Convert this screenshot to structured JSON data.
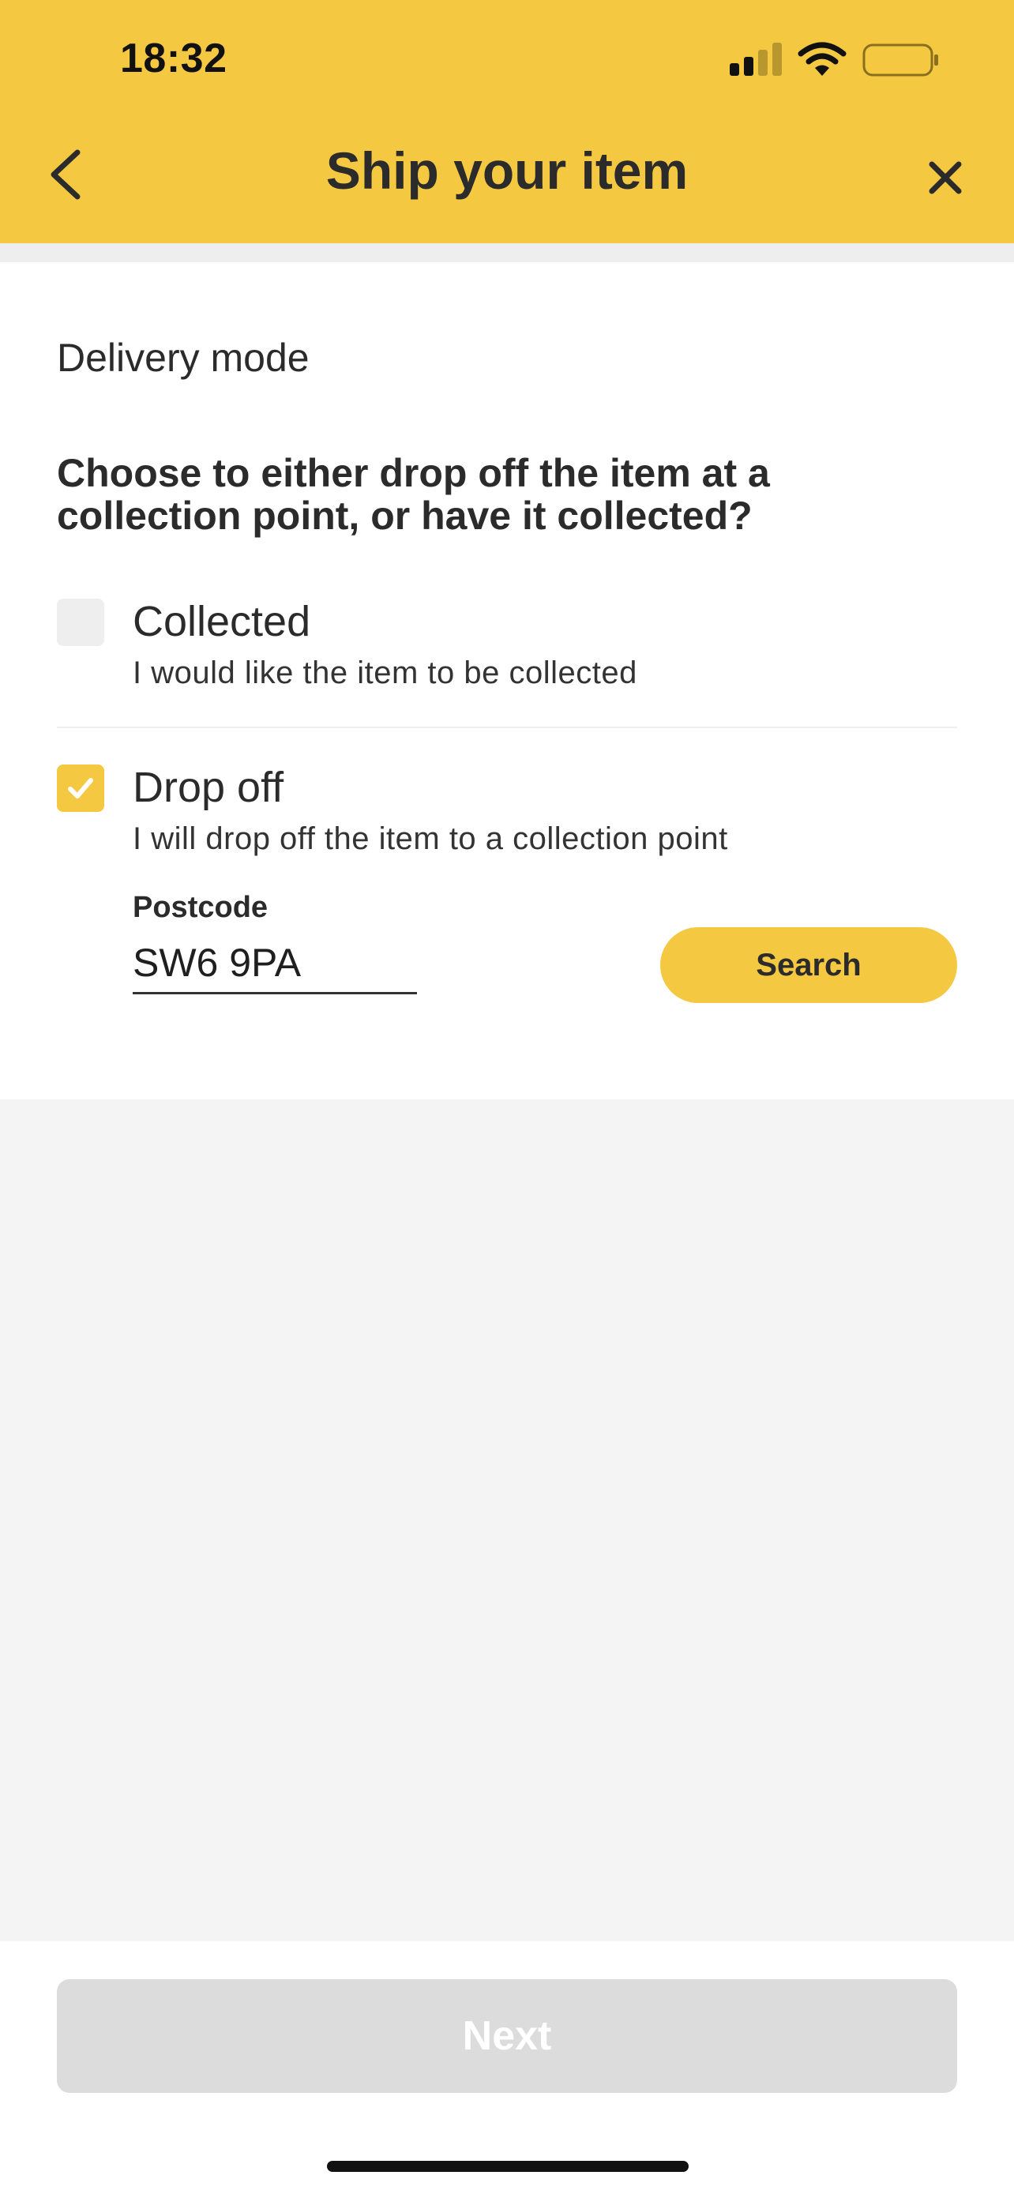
{
  "status_bar": {
    "time": "18:32",
    "signal_icon": "cellular-signal-icon",
    "wifi_icon": "wifi-icon",
    "battery_icon": "battery-icon"
  },
  "header": {
    "title": "Ship your item",
    "back_icon": "chevron-left-icon",
    "close_icon": "close-icon",
    "background_color": "#f5c842"
  },
  "delivery": {
    "section_title": "Delivery mode",
    "question": "Choose to either drop off the item at a collection point, or have it collected?",
    "options": [
      {
        "title": "Collected",
        "description": "I would like the item to be collected",
        "checked": false
      },
      {
        "title": "Drop off",
        "description": "I will drop off the item to a collection point",
        "checked": true
      }
    ],
    "postcode": {
      "label": "Postcode",
      "value": "SW6 9PA"
    },
    "search_label": "Search"
  },
  "footer": {
    "next_label": "Next",
    "next_disabled": true
  },
  "colors": {
    "accent": "#f5c842",
    "disabled_button": "#dcdcdc",
    "text": "#2b2b2b",
    "background": "#f4f4f4"
  }
}
